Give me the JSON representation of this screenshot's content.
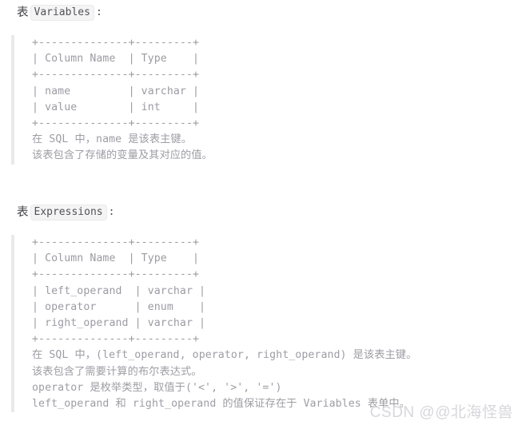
{
  "document": {
    "sections": [
      {
        "id": "variables",
        "heading_prefix": "表",
        "heading_code": "Variables",
        "heading_colon": ":",
        "schema_block": "+--------------+---------+\n| Column Name  | Type    |\n+--------------+---------+\n| name         | varchar |\n| value        | int     |\n+--------------+---------+",
        "notes": [
          "在 SQL 中，name 是该表主键。",
          "该表包含了存储的变量及其对应的值。"
        ]
      },
      {
        "id": "expressions",
        "heading_prefix": "表",
        "heading_code": "Expressions",
        "heading_colon": ":",
        "schema_block": "+--------------+---------+\n| Column Name  | Type    |\n+--------------+---------+\n| left_operand  | varchar |\n| operator      | enum    |\n| right_operand | varchar |\n+--------------+---------+",
        "notes": [
          "在 SQL 中，(left_operand, operator, right_operand) 是该表主键。",
          "该表包含了需要计算的布尔表达式。",
          "operator 是枚举类型，取值于('<', '>', '=')",
          "left_operand 和 right_operand 的值保证存在于 Variables 表单中。"
        ]
      }
    ]
  },
  "watermark": {
    "text": "CSDN @@北海怪兽"
  },
  "colors": {
    "text": "#9b9ba3",
    "heading": "#3f3f46",
    "rule": "#e9e9ed",
    "badge_bg": "#f4f4f5",
    "watermark": "#d7d7dc"
  }
}
